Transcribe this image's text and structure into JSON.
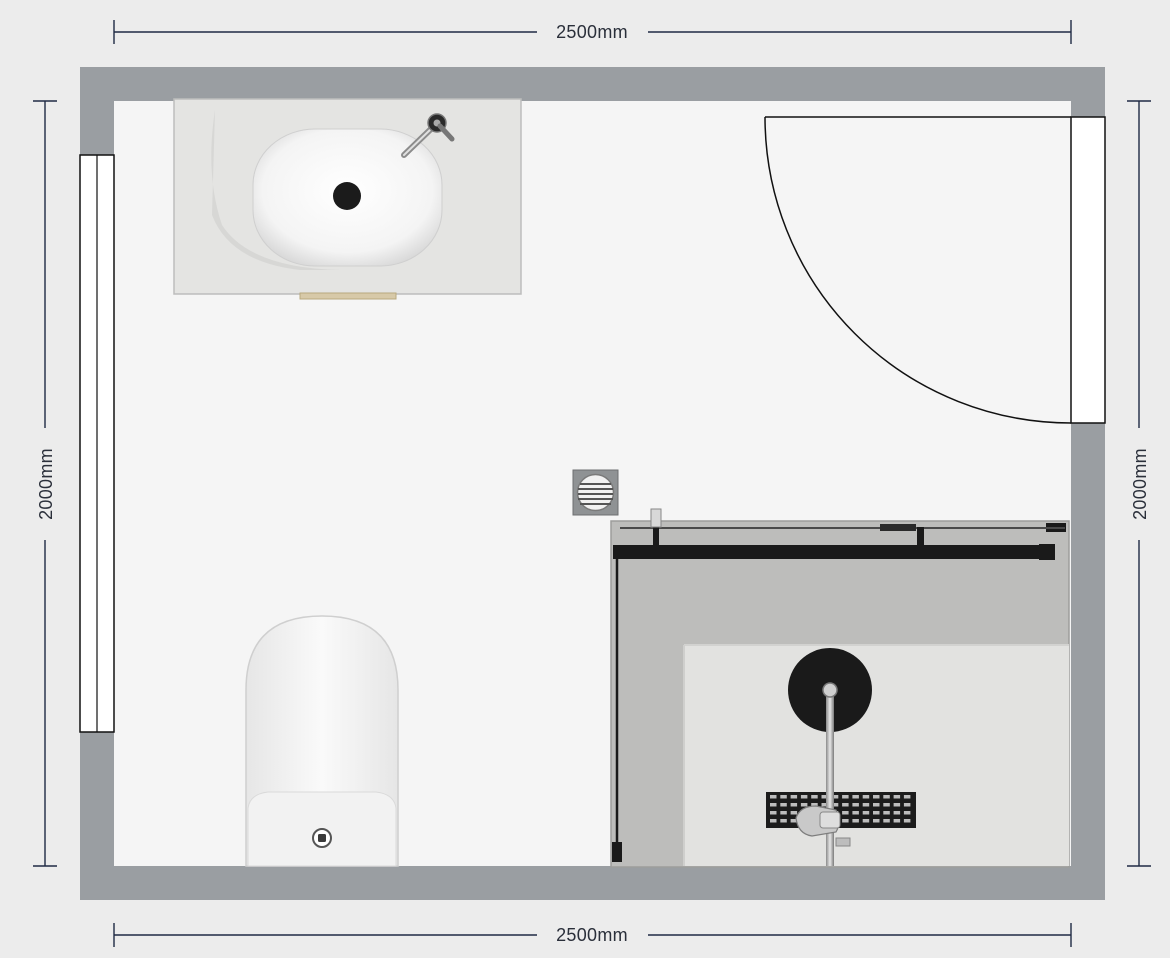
{
  "dimensions": {
    "top_width": "2500mm",
    "bottom_width": "2500mm",
    "left_height": "2000mm",
    "right_height": "2000mm"
  },
  "colors": {
    "background": "#ececec",
    "wall": "#9a9ea2",
    "floor": "#f5f5f5",
    "dimension_line": "#1f2a44",
    "shower_glass": "#bdbdbb",
    "fixture_black": "#1a1a1a",
    "fixture_white": "#f7f7f7"
  },
  "fixtures": [
    "window",
    "vanity-basin",
    "tap",
    "door",
    "floor-waste",
    "toilet",
    "shower-screen",
    "shower-rose",
    "shower-drain-grate"
  ]
}
